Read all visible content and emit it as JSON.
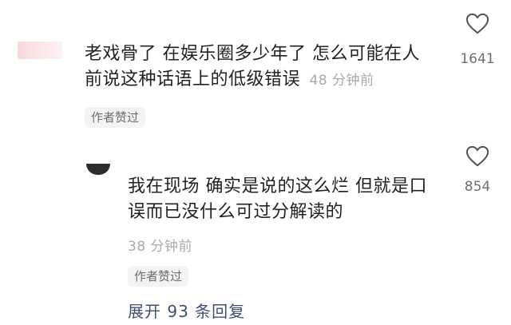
{
  "comments": [
    {
      "text_line1": "老戏骨了 在娱乐圈多少年了  怎么可能在人",
      "text_line2": "前说这种话语上的低级错误",
      "time": "48 分钟前",
      "badge": "作者赞过",
      "likes": "1641",
      "like_icon": "heart-outline-icon"
    },
    {
      "text_line1": "我在现场 确实是说的这么烂 但就是口",
      "text_line2": "误而已没什么可过分解读的",
      "time": "38 分钟前",
      "badge": "作者赞过",
      "likes": "854",
      "like_icon": "heart-outline-icon"
    }
  ],
  "expand_replies": "展开 93 条回复"
}
